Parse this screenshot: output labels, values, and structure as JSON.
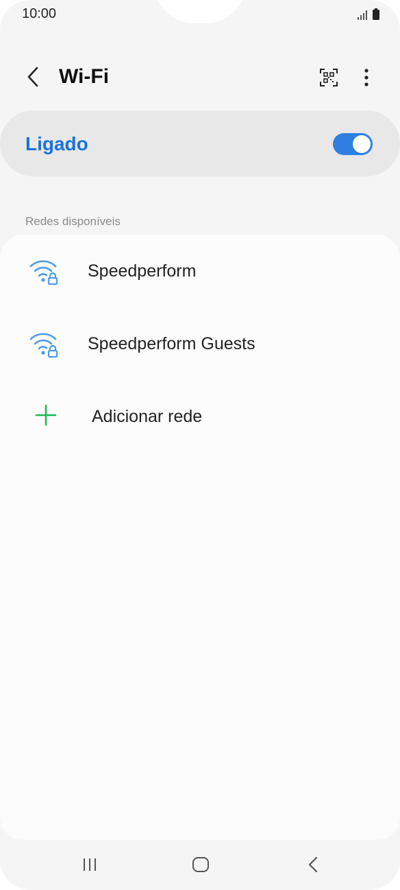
{
  "status_bar": {
    "time": "10:00",
    "icons": [
      "signal-icon",
      "battery-icon"
    ]
  },
  "header": {
    "title": "Wi-Fi",
    "icons": [
      "back-arrow-icon",
      "qr-code-icon",
      "more-vert-icon"
    ]
  },
  "wifi_toggle": {
    "label": "Ligado",
    "state": "on"
  },
  "available_networks": {
    "section_label": "Redes disponíveis",
    "networks": [
      {
        "name": "Speedperform",
        "icon": "wifi-locked-icon"
      },
      {
        "name": "Speedperform Guests",
        "icon": "wifi-locked-icon"
      }
    ],
    "add_network_label": "Adicionar rede"
  },
  "nav_bar": {
    "icons": [
      "recents-icon",
      "home-icon",
      "back-icon"
    ]
  },
  "colors": {
    "accent": "#1a73d9",
    "switch_on": "#2f7fe0",
    "wifi_icon": "#4a9be8",
    "add_icon": "#1db954",
    "background": "#f5f5f5",
    "card": "#fcfcfc",
    "toggle_card": "#e8e8e8"
  }
}
